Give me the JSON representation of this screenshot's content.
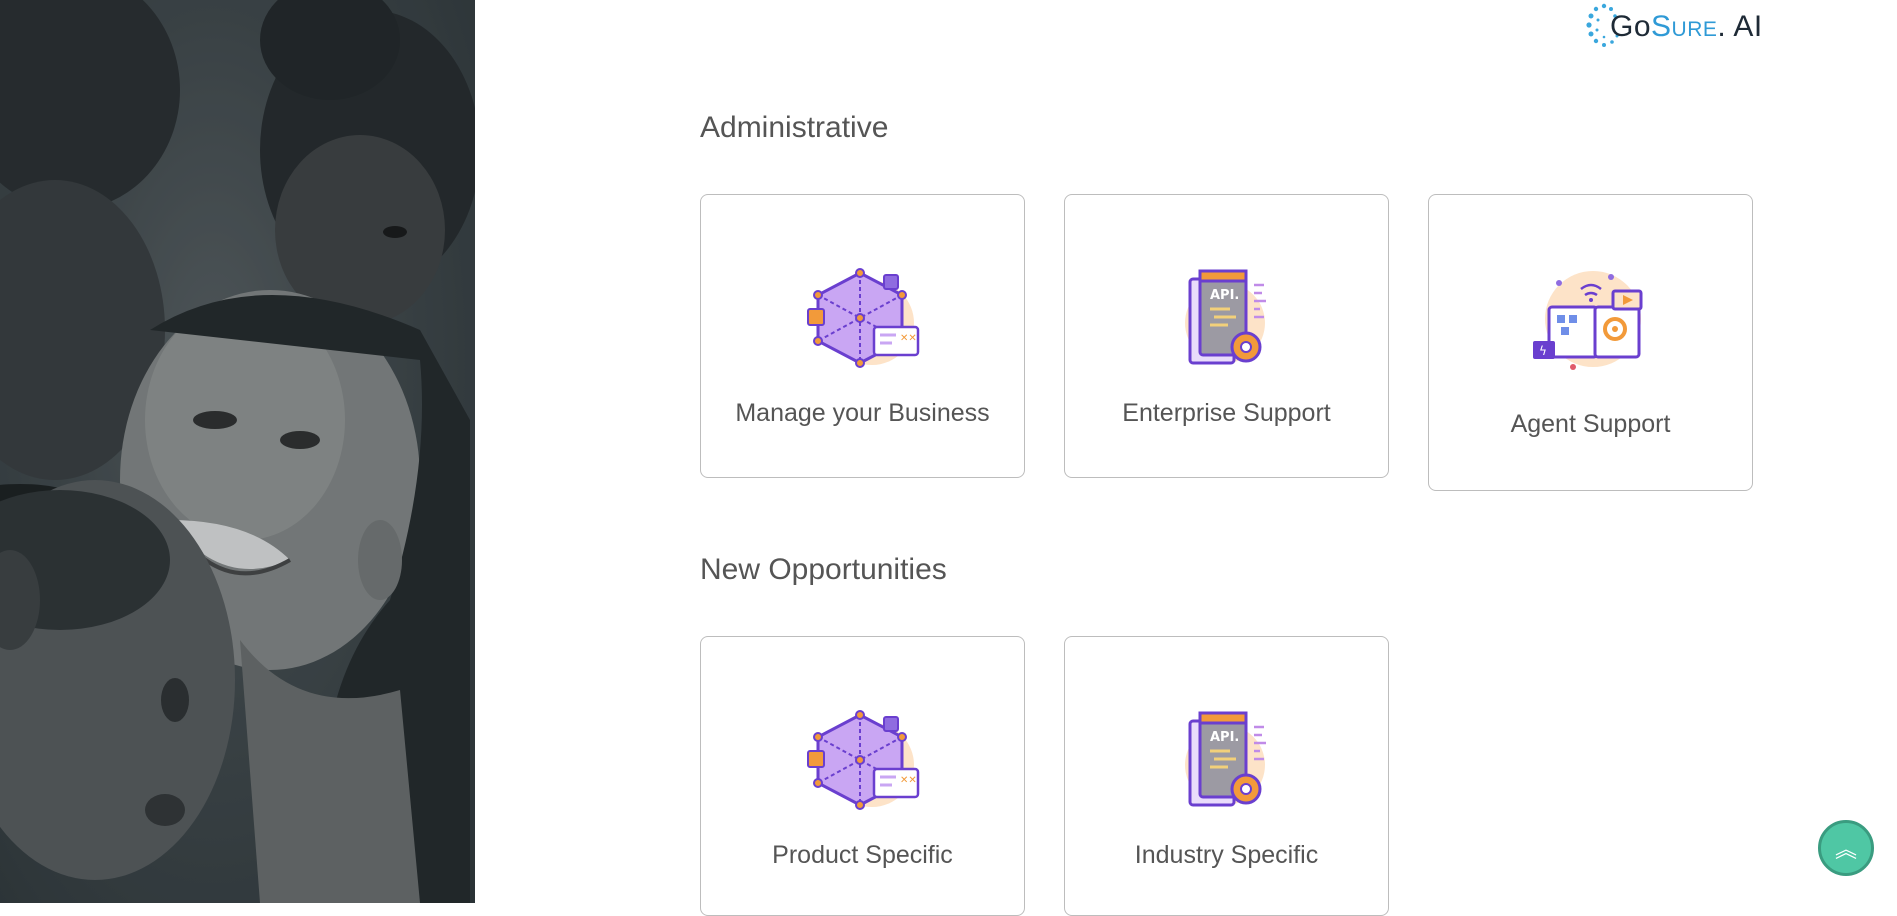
{
  "brand": {
    "logo_go": "Go",
    "logo_sure": "Sure",
    "logo_ai": ". AI"
  },
  "sections": [
    {
      "title": "Administrative",
      "cards": [
        {
          "label": "Manage your Business",
          "icon": "network-hexagon-icon"
        },
        {
          "label": "Enterprise Support",
          "icon": "api-document-gear-icon"
        },
        {
          "label": "Agent Support",
          "icon": "iot-devices-icon"
        }
      ]
    },
    {
      "title": "New Opportunities",
      "cards": [
        {
          "label": "Product Specific",
          "icon": "network-hexagon-icon"
        },
        {
          "label": "Industry Specific",
          "icon": "api-document-gear-icon"
        }
      ]
    }
  ],
  "api_badge_text": "API.",
  "scroll_top": {
    "icon": "double-chevron-up-icon",
    "glyph": "︽"
  },
  "colors": {
    "accent_purple": "#7b4bd6",
    "accent_orange": "#f29a3a",
    "scroll_button": "#4fc7a4",
    "logo_blue": "#2f9ad6",
    "logo_dark": "#1e2a36"
  }
}
